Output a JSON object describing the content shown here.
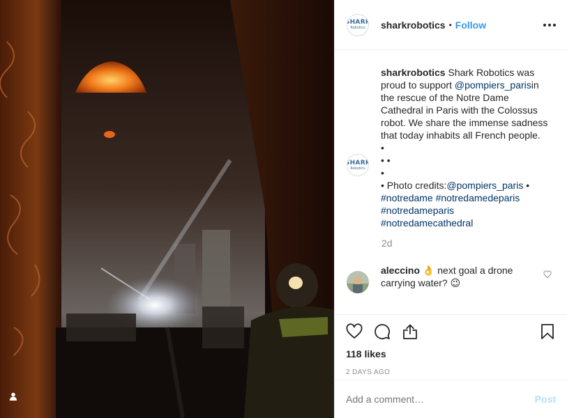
{
  "header": {
    "avatar_line1": "SHARK",
    "avatar_line2": "Robotics",
    "username": "sharkrobotics",
    "dot": "•",
    "follow": "Follow",
    "more_icon": "more-horizontal-icon"
  },
  "caption": {
    "username": "sharkrobotics",
    "text_before_mention": "Shark Robotics was proud to support",
    "mention": "@pompiers_paris",
    "text_after_mention": "in the rescue of the Notre Dame Cathedral in Paris with the Colossus robot. We share the immense sadness that today inhabits all French people.",
    "bullet_lines": [
      "•",
      "• •",
      "•"
    ],
    "credits_prefix": "• Photo credits:",
    "credits_mention": "@pompiers_paris",
    "credits_suffix": " •",
    "hashtags_line1": "#notredame #notredamedeparis",
    "hashtags_line2": "#notredameparis",
    "hashtags_line3": "#notredamecathedral",
    "age": "2d"
  },
  "comment": {
    "username": "aleccino",
    "text": "👌 next goal a drone carrying water? 😉"
  },
  "actions": {
    "like_icon": "heart-icon",
    "comment_icon": "comment-icon",
    "share_icon": "share-icon",
    "save_icon": "bookmark-icon",
    "likes": "118 likes",
    "date": "2 DAYS AGO"
  },
  "add_comment": {
    "placeholder": "Add a comment…",
    "post": "Post"
  },
  "colors": {
    "link": "#003569",
    "follow": "#3897f0",
    "muted": "#8e8e8e",
    "border": "#efefef"
  }
}
